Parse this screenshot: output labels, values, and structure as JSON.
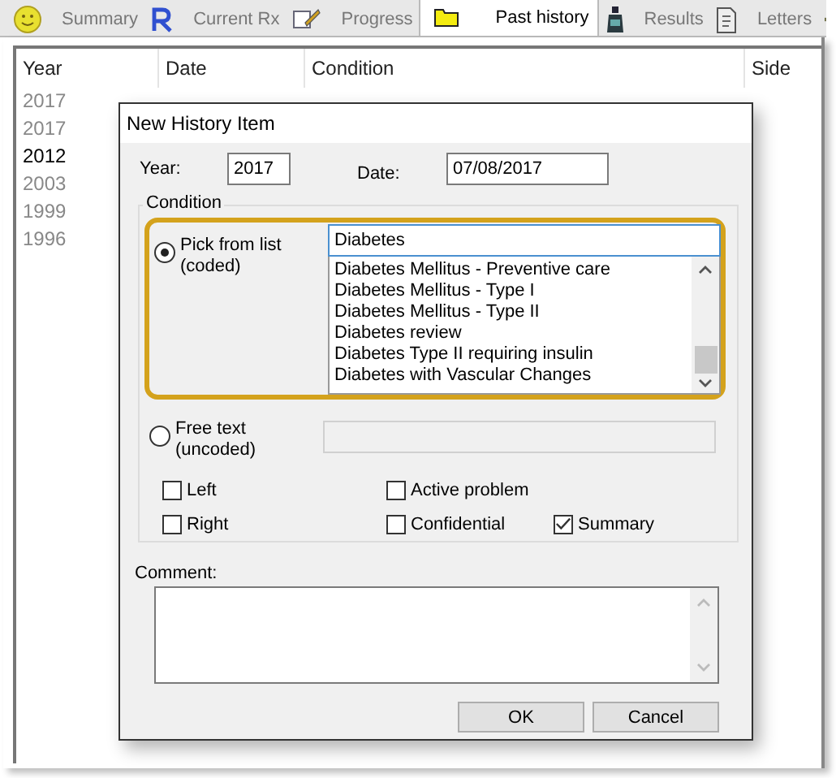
{
  "tabs": [
    {
      "label": "Summary",
      "selected": false
    },
    {
      "label": "Current Rx",
      "selected": false
    },
    {
      "label": "Progress",
      "selected": false
    },
    {
      "label": "Past history",
      "selected": true
    },
    {
      "label": "Results",
      "selected": false
    },
    {
      "label": "Letters",
      "selected": false
    }
  ],
  "table": {
    "columns": [
      "Year",
      "Date",
      "Condition",
      "Side"
    ],
    "rows": [
      {
        "year": "2017",
        "active": false
      },
      {
        "year": "2017",
        "active": false
      },
      {
        "year": "2012",
        "active": true
      },
      {
        "year": "2003",
        "active": false
      },
      {
        "year": "1999",
        "active": false
      },
      {
        "year": "1996",
        "active": false
      }
    ]
  },
  "dialog": {
    "title": "New History Item",
    "year": {
      "label": "Year:",
      "value": "2017"
    },
    "date": {
      "label": "Date:",
      "value": "07/08/2017"
    },
    "condition": {
      "legend": "Condition",
      "pick": {
        "label": "Pick from list",
        "sublabel": "(coded)",
        "selected": true,
        "search": "Diabetes",
        "items": [
          "Diabetes Mellitus - Preventive care",
          "Diabetes Mellitus - Type I",
          "Diabetes Mellitus - Type II",
          "Diabetes review",
          "Diabetes Type II requiring insulin",
          "Diabetes with Vascular Changes"
        ]
      },
      "free": {
        "label": "Free text",
        "sublabel": "(uncoded)",
        "selected": false,
        "disabled": true
      },
      "checkboxes": [
        {
          "label": "Left",
          "checked": false
        },
        {
          "label": "Active problem",
          "checked": false
        },
        {
          "label": "Right",
          "checked": false
        },
        {
          "label": "Confidential",
          "checked": false
        },
        {
          "label": "Summary",
          "checked": true
        }
      ]
    },
    "comment": {
      "label": "Comment:"
    },
    "buttons": [
      "OK",
      "Cancel"
    ]
  }
}
